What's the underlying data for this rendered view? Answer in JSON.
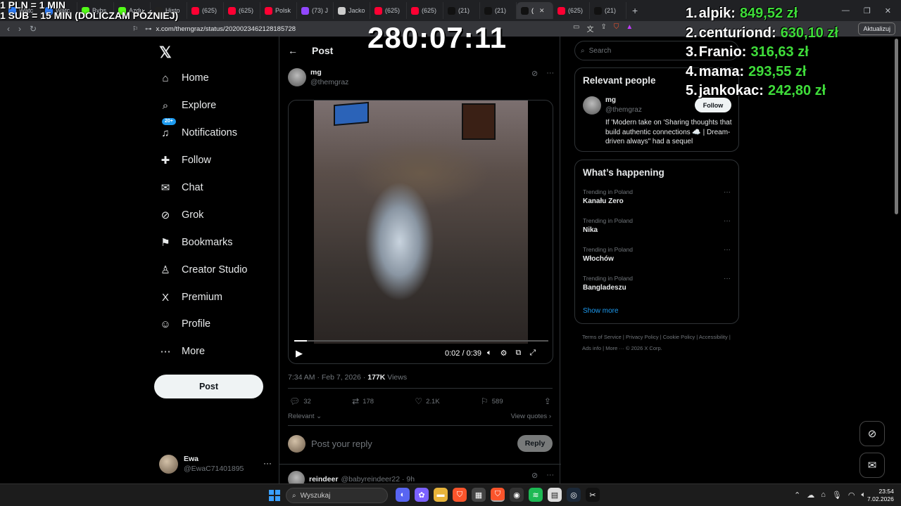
{
  "browser": {
    "tabs": [
      {
        "label": "Watc",
        "color": "#2e7cf6"
      },
      {
        "label": "Watc",
        "color": "#2e7cf6"
      },
      {
        "label": "Bybs",
        "color": "#53fc18"
      },
      {
        "label": "Azdu",
        "color": "#53fc18"
      },
      {
        "label": "Histo",
        "color": "#222222"
      },
      {
        "label": "(625)",
        "color": "#ff0033"
      },
      {
        "label": "(625)",
        "color": "#ff0033"
      },
      {
        "label": "Polsk",
        "color": "#ff0033"
      },
      {
        "label": "(73) J",
        "color": "#9147ff"
      },
      {
        "label": "Jacko",
        "color": "#cccccc"
      },
      {
        "label": "(625)",
        "color": "#ff0033"
      },
      {
        "label": "(625)",
        "color": "#ff0033"
      },
      {
        "label": "(21)",
        "color": "#111111"
      },
      {
        "label": "(21)",
        "color": "#111111"
      },
      {
        "label": "(",
        "color": "#111111",
        "active": true
      },
      {
        "label": "(625)",
        "color": "#ff0033"
      },
      {
        "label": "(21)",
        "color": "#111111"
      }
    ],
    "url": "x.com/themgraz/status/2020023462128185728",
    "update_label": "Aktualizuj"
  },
  "overlay": {
    "rule1": "1 PLN = 1 MIN",
    "rule2": "1 SUB = 15 MIN (DOLICZAM PÓŹNIEJ)",
    "timer": "280:07:11",
    "leaderboard": [
      {
        "rank": "1.",
        "name": "alpik:",
        "amount": "849,52 zł"
      },
      {
        "rank": "2.",
        "name": "centuriond:",
        "amount": "630,10 zł"
      },
      {
        "rank": "3.",
        "name": "Franio:",
        "amount": "316,63 zł"
      },
      {
        "rank": "4.",
        "name": "mama:",
        "amount": "293,55 zł"
      },
      {
        "rank": "5.",
        "name": "jankokac:",
        "amount": "242,80 zł"
      }
    ]
  },
  "nav": {
    "items": [
      {
        "label": "Home",
        "icon": "⌂"
      },
      {
        "label": "Explore",
        "icon": "⌕"
      },
      {
        "label": "Notifications",
        "icon": "♫",
        "badge": "20+"
      },
      {
        "label": "Follow",
        "icon": "✚"
      },
      {
        "label": "Chat",
        "icon": "✉"
      },
      {
        "label": "Grok",
        "icon": "⊘"
      },
      {
        "label": "Bookmarks",
        "icon": "⚑"
      },
      {
        "label": "Creator Studio",
        "icon": "♙"
      },
      {
        "label": "Premium",
        "icon": "X"
      },
      {
        "label": "Profile",
        "icon": "☺"
      },
      {
        "label": "More",
        "icon": "⋯"
      }
    ],
    "post_button": "Post",
    "account": {
      "name": "Ewa",
      "handle": "@EwaC71401895"
    }
  },
  "post": {
    "header": "Post",
    "author_name": "mg",
    "author_handle": "@themgraz",
    "video": {
      "time": "0:02 / 0:39",
      "progress": 0.05
    },
    "timestamp": "7:34 AM · Feb 7, 2026 · ",
    "views_count": "177K",
    "views_label": " Views",
    "stats": {
      "replies": "32",
      "reposts": "178",
      "likes": "2.1K",
      "bookmarks": "589"
    },
    "relevant_label": "Relevant",
    "view_quotes": "View quotes",
    "reply_placeholder": "Post your reply",
    "reply_button": "Reply",
    "first_reply": {
      "name": "reindeer",
      "handle": "@babyreindeer22 · 9h"
    }
  },
  "sidebar": {
    "search_placeholder": "Search",
    "relevant_title": "Relevant people",
    "person": {
      "name": "mg",
      "handle": "@themgraz",
      "follow": "Follow",
      "bio": "If 'Modern take on 'Sharing thoughts that build authentic connections ☁️ | Dream-driven always\" had a sequel"
    },
    "happening_title": "What’s happening",
    "trends": [
      {
        "category": "Trending in Poland",
        "name": "Kanału Zero"
      },
      {
        "category": "Trending in Poland",
        "name": "Nika"
      },
      {
        "category": "Trending in Poland",
        "name": "Włochów"
      },
      {
        "category": "Trending in Poland",
        "name": "Bangladeszu"
      }
    ],
    "show_more": "Show more",
    "footer": "Terms of Service  |  Privacy Policy  |  Cookie Policy  |  Accessibility  |  Ads info  |  More ···  © 2026 X Corp."
  },
  "taskbar": {
    "search_placeholder": "Wyszukaj",
    "time": "23:54",
    "date": "7.02.2026"
  }
}
